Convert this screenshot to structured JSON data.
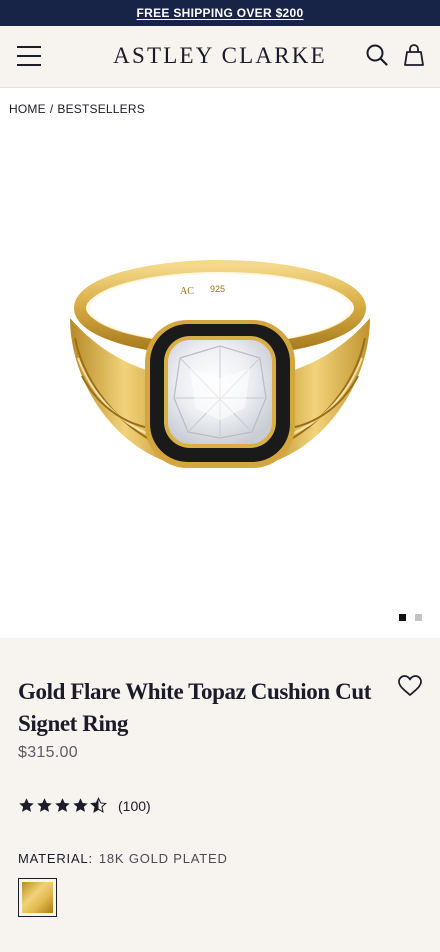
{
  "promo": {
    "text": "FREE SHIPPING OVER $200"
  },
  "header": {
    "logo": "ASTLEY CLARKE"
  },
  "breadcrumb": {
    "home": "HOME",
    "separator": "/",
    "current": "BESTSELLERS"
  },
  "gallery": {
    "image_engraving_mark": "AC",
    "image_engraving_925": "925",
    "slide_count": 2,
    "active_slide": 1
  },
  "product": {
    "title": "Gold Flare White Topaz Cushion Cut Signet Ring",
    "price": "$315.00",
    "rating": 4.5,
    "reviews": "(100)",
    "material_label": "MATERIAL:",
    "material_value": "18K GOLD PLATED"
  },
  "colors": {
    "navy": "#172347",
    "gold": "#d9ae45",
    "enamel": "#1a1a1a",
    "star": "#1b1b2a",
    "background": "#f7f3ee"
  }
}
